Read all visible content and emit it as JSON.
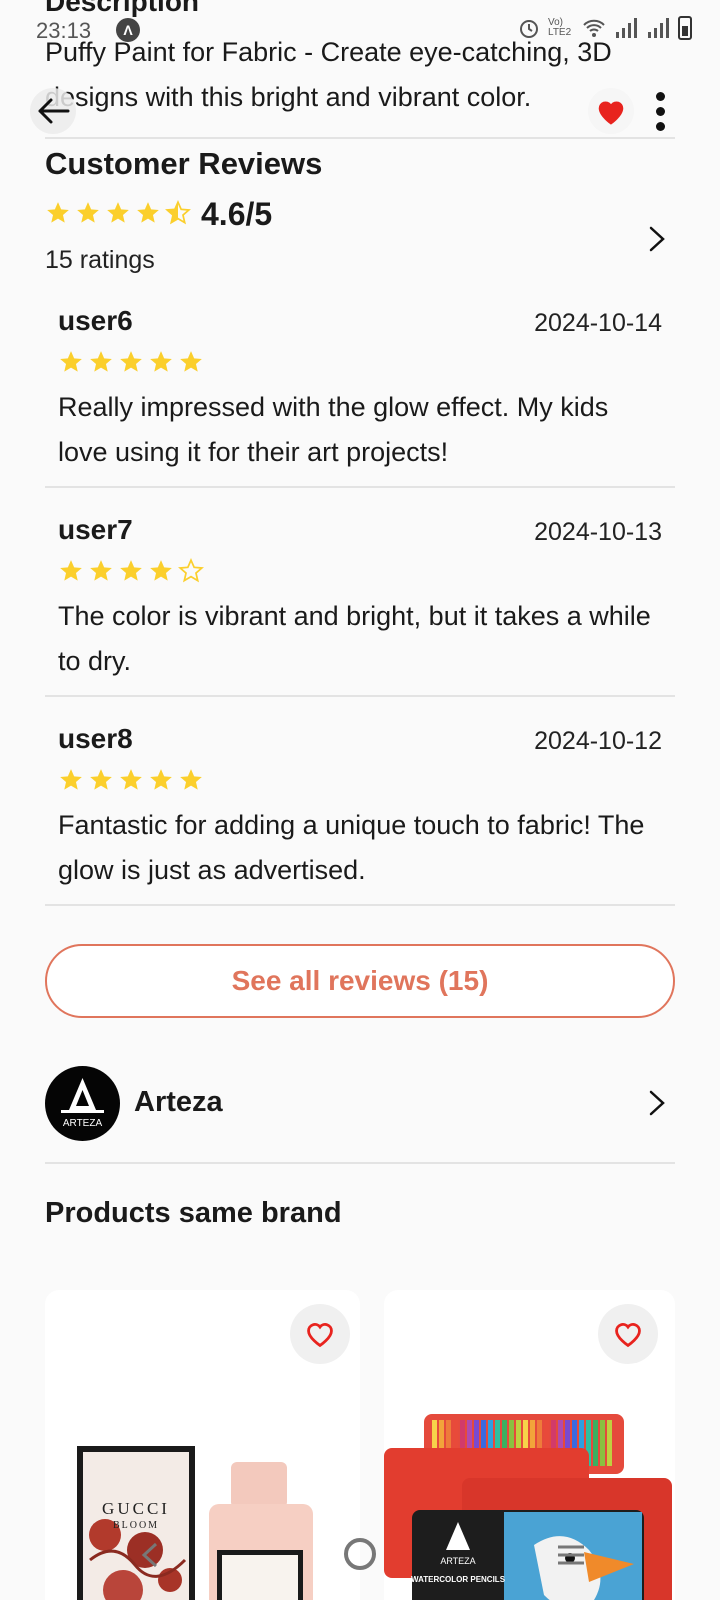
{
  "status_bar": {
    "time": "23:13",
    "lte_label": "Vo) LTE2"
  },
  "description": {
    "heading": "Description",
    "text": "Puffy Paint for Fabric - Create eye-catching, 3D designs with this bright and vibrant color."
  },
  "customer_reviews": {
    "title": "Customer Reviews",
    "score": "4.6/5",
    "rating_value": 4.6,
    "ratings_count": "15 ratings",
    "reviews": [
      {
        "user": "user6",
        "date": "2024-10-14",
        "stars": 5,
        "text": "Really impressed with the glow effect. My kids love using it for their art projects!"
      },
      {
        "user": "user7",
        "date": "2024-10-13",
        "stars": 4,
        "text": "The color is vibrant and bright, but it takes a while to dry."
      },
      {
        "user": "user8",
        "date": "2024-10-12",
        "stars": 5,
        "text": "Fantastic for adding a unique touch to fabric! The glow is just as advertised."
      }
    ],
    "see_all_label": "See all reviews (15)"
  },
  "brand": {
    "name": "Arteza",
    "logo_text": "ARTEZA"
  },
  "same_brand": {
    "title": "Products same brand",
    "products": [
      {
        "image": "gucci-bloom-perfume",
        "logo_text": "GUCCI",
        "sub_text": "BLOOM"
      },
      {
        "image": "arteza-watercolor-pencils",
        "logo_text": "ARTEZA",
        "sub_text": "WATERCOLOR PENCILS"
      }
    ]
  },
  "colors": {
    "accent": "#e0755c",
    "star": "#fbcf2c",
    "heart": "#e8231e"
  }
}
